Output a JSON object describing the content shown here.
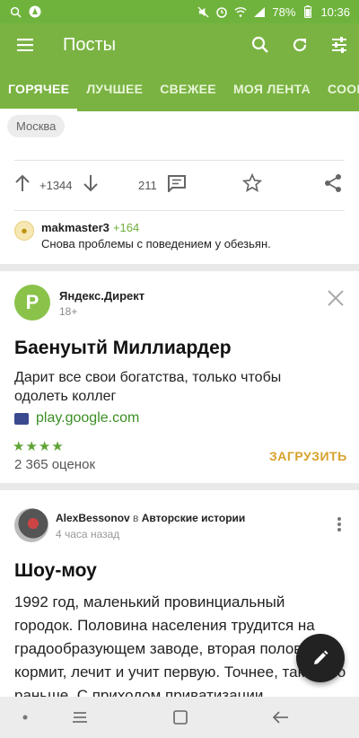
{
  "status_bar": {
    "time": "10:36",
    "battery": "78%",
    "left_icons": [
      "search-icon",
      "app-icon"
    ],
    "right_icons": [
      "mute-icon",
      "alarm-icon",
      "wifi-icon",
      "signal-icon",
      "battery-icon"
    ]
  },
  "app_bar": {
    "title": "Посты",
    "background": "#7ab342",
    "actions": [
      "search-icon",
      "refresh-icon",
      "filter-icon"
    ]
  },
  "tabs": [
    {
      "label": "ГОРЯЧЕЕ",
      "active": true
    },
    {
      "label": "ЛУЧШЕЕ",
      "active": false
    },
    {
      "label": "СВЕЖЕЕ",
      "active": false
    },
    {
      "label": "МОЯ ЛЕНТА",
      "active": false
    },
    {
      "label": "СООБЩЕСТВА",
      "active": false
    }
  ],
  "post1": {
    "tag": "Москва",
    "rating": "+1344",
    "comments": "211",
    "top_comment": {
      "author": "makmaster3",
      "rating": "+164",
      "text": "Снова проблемы с поведением у обезьян."
    }
  },
  "ad": {
    "logo_letter": "P",
    "source": "Яндекс.Директ",
    "age": "18+",
    "title": "Баенуытй Миллиардер",
    "description": "Дарит все свои богатства, только чтобы одолеть коллег",
    "link": "play.google.com",
    "stars": "★★★★",
    "rating_fraction": 0.8,
    "reviews": "2 365 оценок",
    "cta": "ЗАГРУЗИТЬ"
  },
  "post2": {
    "author": "AlexBessonov",
    "in_label": "в",
    "community": "Авторские истории",
    "time": "4 часа назад",
    "title": "Шоу-моу",
    "body": "1992 год, маленький провинциальный городок. Половина населения трудится на градообразующем заводе, вторая половина кормит, лечит и учит первую. Точнее, так было раньше. С приходом приватизации"
  },
  "colors": {
    "accent_green": "#7ab342",
    "cta_orange": "#d9a12b",
    "link_green": "#3c8e24"
  }
}
